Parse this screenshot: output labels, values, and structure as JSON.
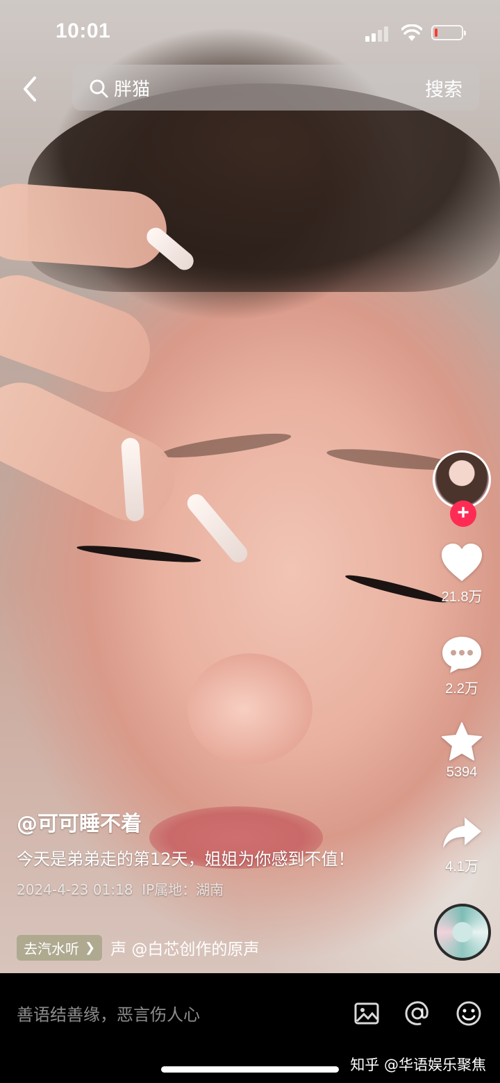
{
  "status_bar": {
    "time": "10:01",
    "battery_level": 0.1,
    "battery_color": "#ff3b30"
  },
  "search": {
    "query": "胖猫",
    "button_label": "搜索"
  },
  "rail": {
    "follow_symbol": "+",
    "follow_color": "#fe2c55",
    "like_count": "21.8万",
    "comment_count": "2.2万",
    "favorite_count": "5394",
    "share_count": "4.1万"
  },
  "post": {
    "author": "@可可睡不着",
    "description": "今天是弟弟走的第12天，姐姐为你感到不值！",
    "timestamp": "2024-4-23 01:18",
    "ip_location": "IP属地：湖南",
    "listen_chip": "去汽水听",
    "music": "声    @白芯创作的原声"
  },
  "bottom_bar": {
    "comment_placeholder": "善语结善缘，恶言伤人心",
    "watermark": "知乎 @华语娱乐聚焦"
  },
  "icons": [
    "back-icon",
    "search-icon",
    "heart-icon",
    "comment-icon",
    "star-icon",
    "share-icon",
    "image-icon",
    "mention-icon",
    "emoji-icon"
  ]
}
